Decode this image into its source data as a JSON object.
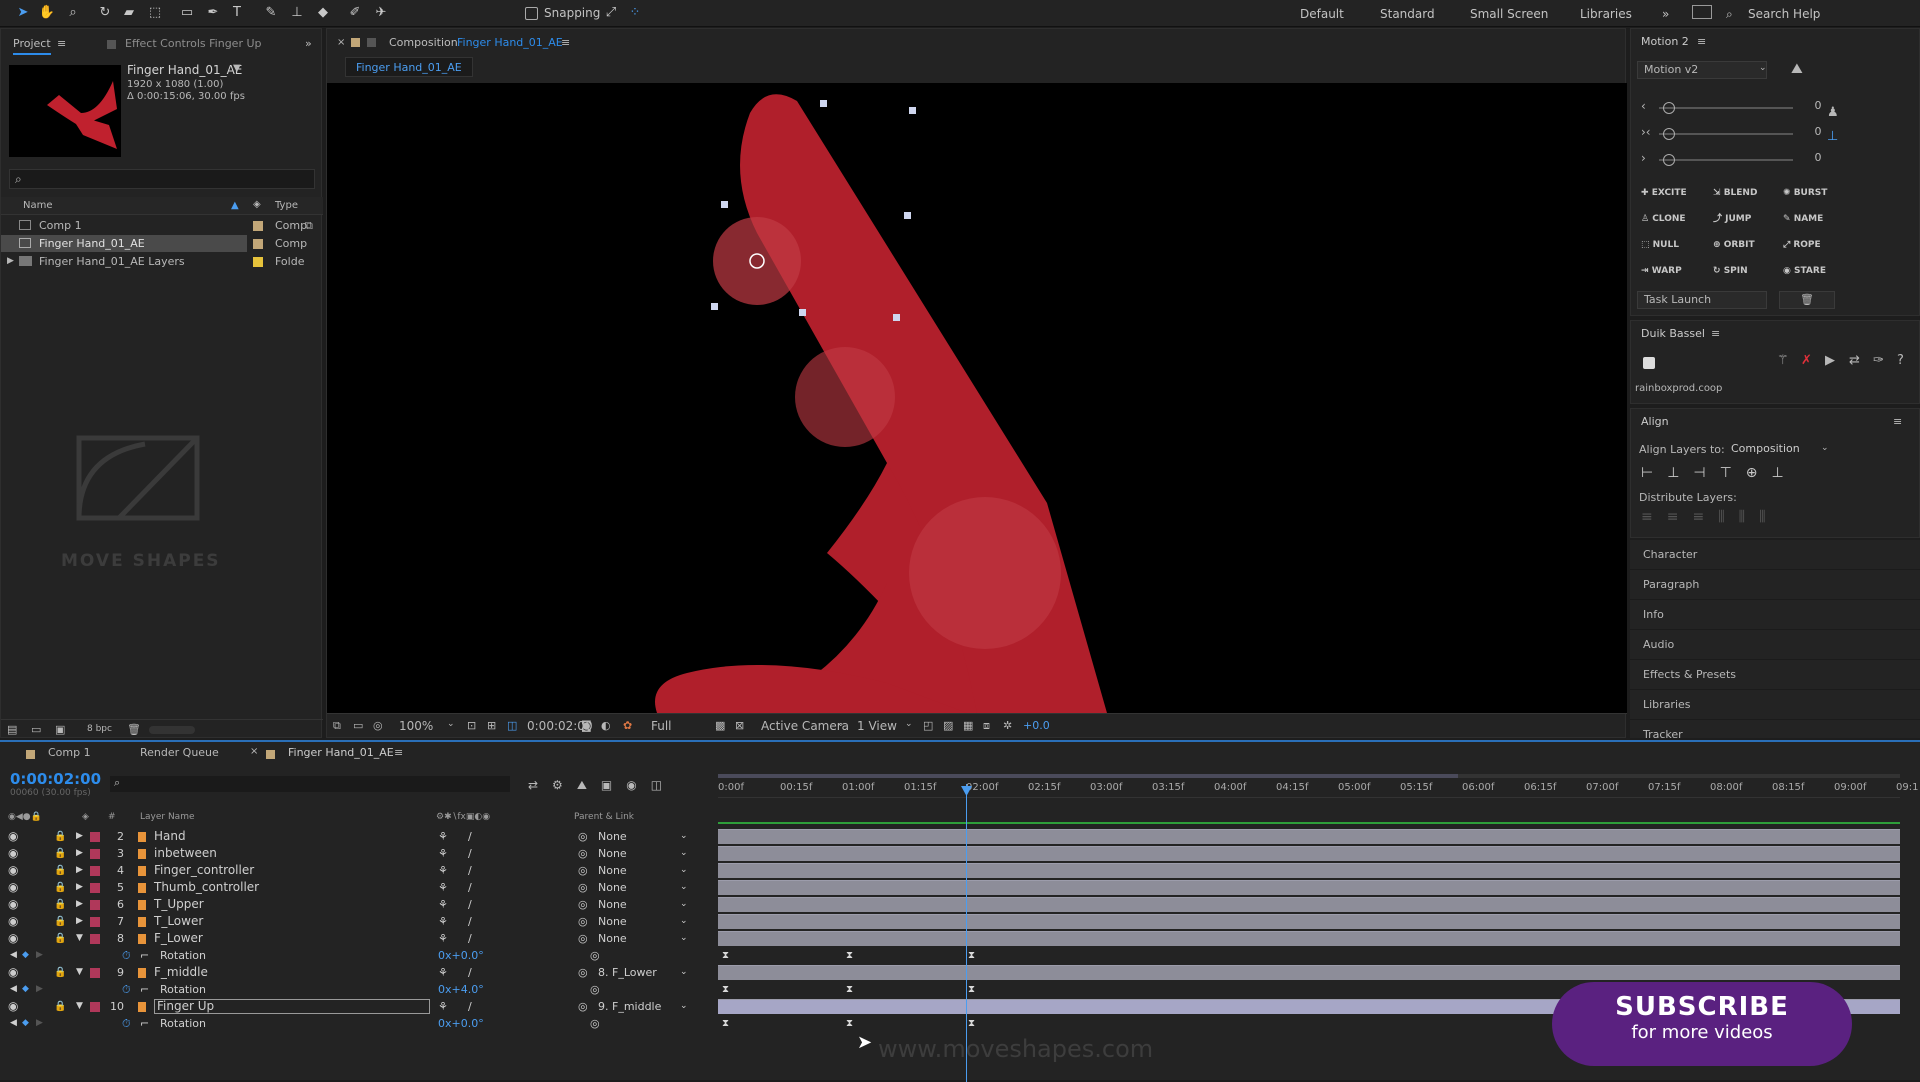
{
  "toolbar": {
    "snapping": "Snapping",
    "workspaces": [
      "Default",
      "Standard",
      "Small Screen",
      "Libraries"
    ],
    "search_placeholder": "Search Help"
  },
  "project": {
    "tab": "Project",
    "effect_tab": "Effect Controls Finger Up",
    "item_name": "Finger Hand_01_AE",
    "item_res": "1920 x 1080 (1.00)",
    "item_dur": "Δ 0:00:15:06, 30.00 fps",
    "col_name": "Name",
    "col_type": "Type",
    "items": [
      {
        "name": "Comp 1",
        "type": "Comp"
      },
      {
        "name": "Finger Hand_01_AE",
        "type": "Comp"
      },
      {
        "name": "Finger Hand_01_AE Layers",
        "type": "Folde"
      }
    ],
    "watermark": "MOVE SHAPES",
    "bpc": "8 bpc"
  },
  "comp": {
    "tab_prefix": "Composition",
    "tab_name": "Finger Hand_01_AE",
    "subtab": "Finger Hand_01_AE",
    "zoom": "100%",
    "time": "0:00:02:00",
    "quality": "Full",
    "camera": "Active Camera",
    "views": "1 View",
    "exposure": "+0.0"
  },
  "motion": {
    "title": "Motion 2",
    "version": "Motion v2",
    "slider_values": [
      "0",
      "0",
      "0"
    ],
    "buttons": [
      [
        "EXCITE",
        "BLEND",
        "BURST"
      ],
      [
        "CLONE",
        "JUMP",
        "NAME"
      ],
      [
        "NULL",
        "ORBIT",
        "ROPE"
      ],
      [
        "WARP",
        "SPIN",
        "STARE"
      ]
    ],
    "task": "Task Launch"
  },
  "duik": {
    "title": "Duik Bassel",
    "site": "rainboxprod.coop"
  },
  "align": {
    "title": "Align",
    "align_to_label": "Align Layers to:",
    "align_to": "Composition",
    "distribute": "Distribute Layers:"
  },
  "side_panels": [
    "Character",
    "Paragraph",
    "Info",
    "Audio",
    "Effects & Presets",
    "Libraries",
    "Tracker"
  ],
  "timeline": {
    "tabs": [
      "Comp 1",
      "Render Queue",
      "Finger Hand_01_AE"
    ],
    "timecode": "0:00:02:00",
    "frames": "00060 (30.00 fps)",
    "col_layer": "Layer Name",
    "col_parent": "Parent & Link",
    "ruler": [
      "0:00f",
      "00:15f",
      "01:00f",
      "01:15f",
      "02:00f",
      "02:15f",
      "03:00f",
      "03:15f",
      "04:00f",
      "04:15f",
      "05:00f",
      "05:15f",
      "06:00f",
      "06:15f",
      "07:00f",
      "07:15f",
      "08:00f",
      "08:15f",
      "09:00f",
      "09:1"
    ],
    "layers": [
      {
        "num": "2",
        "name": "Hand",
        "parent": "None"
      },
      {
        "num": "3",
        "name": "inbetween",
        "parent": "None"
      },
      {
        "num": "4",
        "name": "Finger_controller",
        "parent": "None"
      },
      {
        "num": "5",
        "name": "Thumb_controller",
        "parent": "None"
      },
      {
        "num": "6",
        "name": "T_Upper",
        "parent": "None"
      },
      {
        "num": "7",
        "name": "T_Lower",
        "parent": "None"
      },
      {
        "num": "8",
        "name": "F_Lower",
        "parent": "None"
      },
      {
        "num": "",
        "name": "Rotation",
        "value": "0x+0.0°"
      },
      {
        "num": "9",
        "name": "F_middle",
        "parent": "8. F_Lower"
      },
      {
        "num": "",
        "name": "Rotation",
        "value": "0x+4.0°"
      },
      {
        "num": "10",
        "name": "Finger Up",
        "parent": "9. F_middle"
      },
      {
        "num": "",
        "name": "Rotation",
        "value": "0x+0.0°"
      }
    ]
  },
  "overlay": {
    "url": "www.moveshapes.com",
    "subscribe": "SUBSCRIBE",
    "subscribe_sub": "for more videos"
  },
  "colors": {
    "accent": "#2d8ceb",
    "shape": "#c0212e",
    "subscribe_bg": "#5a2180"
  }
}
